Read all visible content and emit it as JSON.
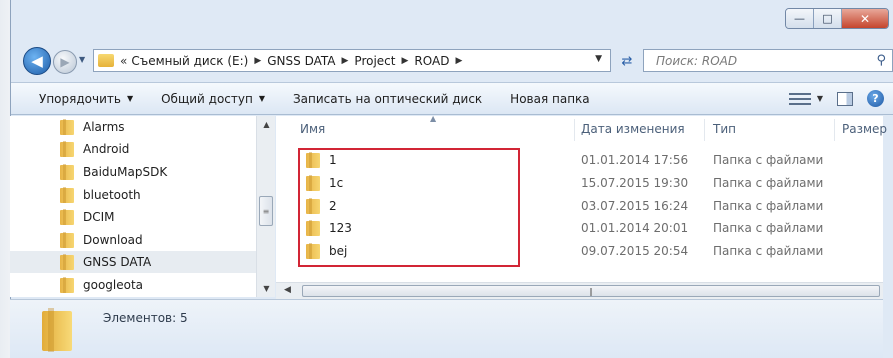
{
  "window": {
    "minimize_label": "—",
    "maximize_label": "□",
    "close_label": "✕"
  },
  "address_bar": {
    "prefix": "«",
    "segments": [
      "Съемный диск (E:)",
      "GNSS DATA",
      "Project",
      "ROAD"
    ],
    "separator": "▶"
  },
  "search": {
    "placeholder": "Поиск: ROAD"
  },
  "toolbar": {
    "organize_label": "Упорядочить",
    "share_label": "Общий доступ",
    "burn_label": "Записать на оптический диск",
    "new_folder_label": "Новая папка"
  },
  "nav_pane": {
    "items": [
      {
        "label": "Alarms",
        "selected": false
      },
      {
        "label": "Android",
        "selected": false
      },
      {
        "label": "BaiduMapSDK",
        "selected": false
      },
      {
        "label": "bluetooth",
        "selected": false
      },
      {
        "label": "DCIM",
        "selected": false
      },
      {
        "label": "Download",
        "selected": false
      },
      {
        "label": "GNSS DATA",
        "selected": true
      },
      {
        "label": "googleota",
        "selected": false
      }
    ]
  },
  "columns": {
    "name": "Имя",
    "date": "Дата изменения",
    "type": "Тип",
    "size": "Размер"
  },
  "files": [
    {
      "name": "1",
      "date": "01.01.2014 17:56",
      "type": "Папка с файлами"
    },
    {
      "name": "1c",
      "date": "15.07.2015 19:30",
      "type": "Папка с файлами"
    },
    {
      "name": "2",
      "date": "03.07.2015 16:24",
      "type": "Папка с файлами"
    },
    {
      "name": "123",
      "date": "01.01.2014 20:01",
      "type": "Папка с файлами"
    },
    {
      "name": "bej",
      "date": "09.07.2015 20:54",
      "type": "Папка с файлами"
    }
  ],
  "status": {
    "count_text": "Элементов: 5"
  },
  "colors": {
    "highlight_box": "#d22535",
    "accent": "#1e5da8"
  }
}
